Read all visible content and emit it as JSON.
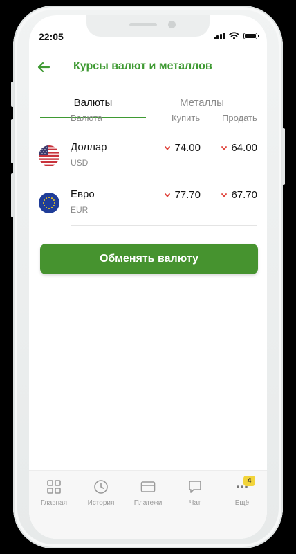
{
  "status_bar": {
    "time": "22:05"
  },
  "header": {
    "title": "Курсы валют и металлов"
  },
  "tabs": [
    {
      "label": "Валюты",
      "active": true
    },
    {
      "label": "Металлы",
      "active": false
    }
  ],
  "table": {
    "columns": {
      "currency": "Валюта",
      "buy": "Купить",
      "sell": "Продать"
    },
    "rows": [
      {
        "name": "Доллар",
        "code": "USD",
        "buy": "74.00",
        "sell": "64.00",
        "flag": "us-flag-icon"
      },
      {
        "name": "Евро",
        "code": "EUR",
        "buy": "77.70",
        "sell": "67.70",
        "flag": "eu-flag-icon"
      }
    ]
  },
  "exchange_button": {
    "label": "Обменять валюту"
  },
  "bottom_nav": {
    "items": [
      {
        "label": "Главная",
        "icon": "grid-icon"
      },
      {
        "label": "История",
        "icon": "clock-icon"
      },
      {
        "label": "Платежи",
        "icon": "card-icon"
      },
      {
        "label": "Чат",
        "icon": "chat-icon"
      },
      {
        "label": "Ещё",
        "icon": "more-icon",
        "badge": "4"
      }
    ]
  },
  "colors": {
    "accent": "#3f9a33",
    "button": "#46932f",
    "down_arrow": "#e0443c",
    "badge": "#f2d43a"
  }
}
